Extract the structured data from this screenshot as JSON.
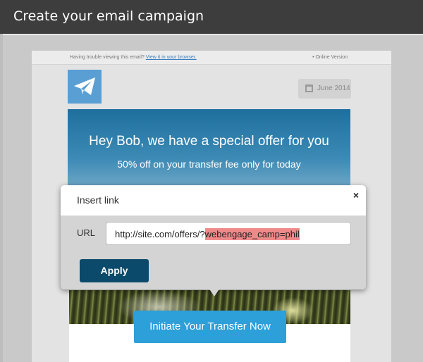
{
  "header": {
    "title": "Create your email campaign"
  },
  "email": {
    "trouble_text": "Having trouble viewing this email?",
    "browser_link": "View it in your browser.",
    "online_version": "• Online Version",
    "date": "June 2014",
    "logo_icon": "telegram-paper-plane-icon",
    "hero_title": "Hey Bob, we have a special offer for you",
    "hero_subtitle": "50% off on your transfer fee only for today",
    "cta_label": "Initiate Your Transfer Now"
  },
  "dialog": {
    "title": "Insert link",
    "close_label": "×",
    "url_label": "URL",
    "url_base": "http://site.com/offers/?",
    "url_highlight": "webengage_camp=phil",
    "apply_label": "Apply"
  },
  "colors": {
    "header_bg": "#3d3d3d",
    "accent": "#2d9fd9",
    "apply_bg": "#0b4a6b",
    "highlight": "#f08a8a",
    "logo_bg": "#5a9fd4"
  }
}
